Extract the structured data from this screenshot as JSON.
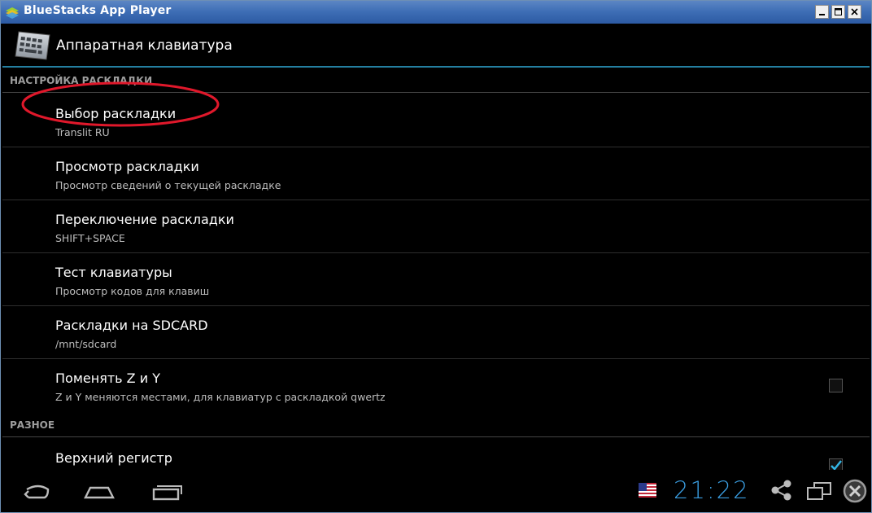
{
  "window": {
    "title": "BlueStacks App Player"
  },
  "actionbar": {
    "title": "Аппаратная клавиатура",
    "icon": "keyboard-icon"
  },
  "sections": [
    {
      "header": "НАСТРОЙКА РАСКЛАДКИ"
    },
    {
      "header": "РАЗНОЕ"
    }
  ],
  "items": [
    {
      "title": "Выбор раскладки",
      "summary": "Translit RU"
    },
    {
      "title": "Просмотр раскладки",
      "summary": "Просмотр сведений о текущей раскладке"
    },
    {
      "title": "Переключение раскладки",
      "summary": "SHIFT+SPACE"
    },
    {
      "title": "Тест клавиатуры",
      "summary": "Просмотр кодов для клавиш"
    },
    {
      "title": "Раскладки на SDCARD",
      "summary": "/mnt/sdcard"
    },
    {
      "title": "Поменять Z и Y",
      "summary": "Z и Y меняются местами, для клавиатур с раскладкой qwertz",
      "checked": false
    },
    {
      "title": "Верхний регистр",
      "checked": true
    }
  ],
  "status": {
    "clock": "21:22",
    "flag": "us-flag-icon"
  },
  "colors": {
    "accent": "#33b5e5",
    "clock": "#3a9de0",
    "highlight": "#e0182b"
  }
}
